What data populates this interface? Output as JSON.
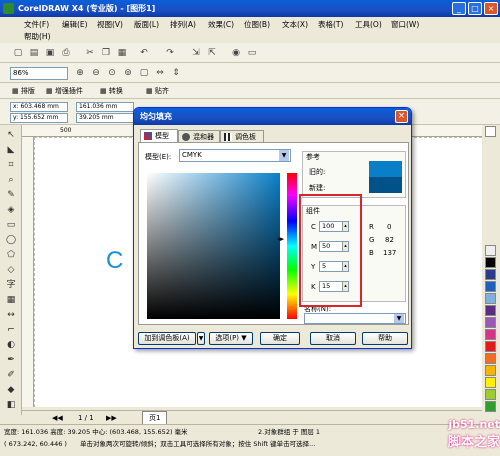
{
  "window": {
    "title": "CorelDRAW X4 (专业版) - [图形1]"
  },
  "menu": [
    "文件(F)",
    "编辑(E)",
    "视图(V)",
    "版面(L)",
    "排列(A)",
    "效果(C)",
    "位图(B)",
    "文本(X)",
    "表格(T)",
    "工具(O)",
    "窗口(W)",
    "帮助(H)"
  ],
  "toolbar": {
    "zoom": "86%"
  },
  "row3": {
    "layout": "排版",
    "enhance": "增强插件",
    "convert": "转换",
    "paste": "贴齐"
  },
  "propbar": {
    "x": "x: 603.468 mm",
    "y": "y: 155.652 mm",
    "w": "161.036 mm",
    "h": "39.205 mm"
  },
  "ruler": {
    "mark1": "500",
    "mark2": "550"
  },
  "dialog": {
    "title": "均匀填充",
    "tabs": [
      "模型",
      "混和器",
      "调色板"
    ],
    "model_label": "模型(E):",
    "model_value": "CMYK",
    "ref_label": "参考",
    "old_label": "旧的:",
    "new_label": "新建:",
    "components_label": "组件",
    "c": "100",
    "m": "50",
    "y": "5",
    "k": "15",
    "r": "0",
    "g": "82",
    "b": "137",
    "name_label": "名称(N):",
    "add_palette": "加到调色板(A)",
    "options": "选项(P)",
    "ok": "确定",
    "cancel": "取消",
    "help": "帮助",
    "colors": {
      "old": "#0a7fc8",
      "new": "#005289"
    }
  },
  "page": {
    "counter": "1 / 1",
    "tab": "页1"
  },
  "status": {
    "line1": "宽度: 161.036 高度: 39.205 中心: (603.468, 155.652) 毫米",
    "line1b": "2.对象群组 于 图层 1",
    "line2": "( 673.242, 60.446 )",
    "line2b": "单击对象两次可旋转/倾斜；双击工具可选择所有对象；按住 Shift 键单击可选择..."
  },
  "canvas_text": "C",
  "watermark": {
    "line1": "jb51.net",
    "line2": "脚本之家"
  },
  "palette": [
    "#ffffff",
    "#000000",
    "#2a3a8c",
    "#1e5fbf",
    "#7fb0e0",
    "#5a2d82",
    "#9b59b6",
    "#d6338b",
    "#e31a1c",
    "#f26d21",
    "#f7b500",
    "#ffef00",
    "#9acd32",
    "#2ca02c"
  ]
}
